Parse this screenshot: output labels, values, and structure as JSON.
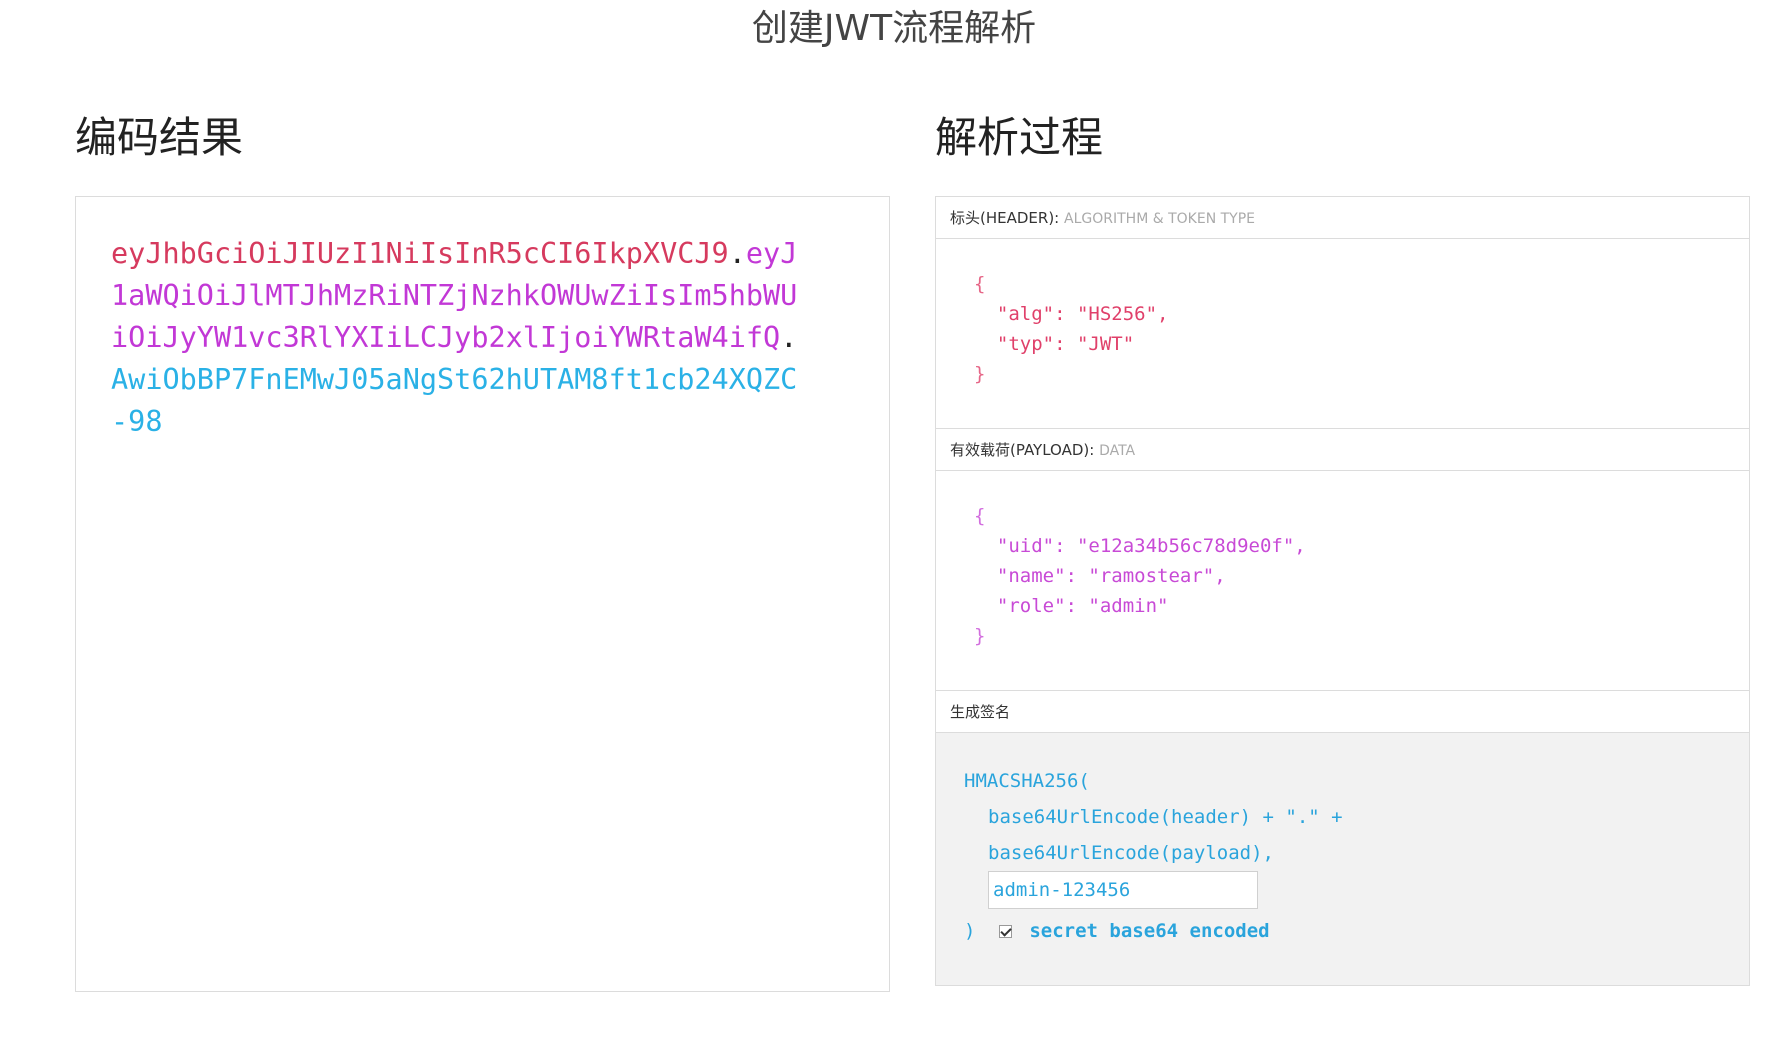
{
  "page": {
    "title": "创建JWT流程解析"
  },
  "encoded": {
    "heading": "编码结果",
    "header_part": "eyJhbGciOiJIUzI1NiIsInR5cCI6IkpXVCJ9",
    "dot1": ".",
    "payload_part": "eyJ1aWQiOiJlMTJhMzRiNTZjNzhkOWUwZiIsIm5hbWUiOiJyYW1vc3RlYXIiLCJyb2xlIjoiYWRtaW4ifQ",
    "dot2": ".",
    "signature_part": "AwiObBP7FnEMwJ05aNgSt62hUTAM8ft1cb24XQZC-98"
  },
  "decoded": {
    "heading": "解析过程",
    "header_section": {
      "label": "标头(HEADER):",
      "sub": "ALGORITHM & TOKEN TYPE",
      "open_brace": "{",
      "lines": [
        "  \"alg\": \"HS256\",",
        "  \"typ\": \"JWT\""
      ],
      "close_brace": "}"
    },
    "payload_section": {
      "label": "有效载荷(PAYLOAD):",
      "sub": "DATA",
      "open_brace": "{",
      "lines": [
        "  \"uid\": \"e12a34b56c78d9e0f\",",
        "  \"name\": \"ramostear\",",
        "  \"role\": \"admin\""
      ],
      "close_brace": "}"
    },
    "signature_section": {
      "label": "生成签名",
      "func": "HMACSHA256(",
      "line1": "base64UrlEncode(header) + \".\" +",
      "line2": "base64UrlEncode(payload),",
      "secret_value": "admin-123456",
      "close_paren": ")",
      "checkbox_checked": true,
      "checkbox_label": "secret base64 encoded"
    }
  }
}
